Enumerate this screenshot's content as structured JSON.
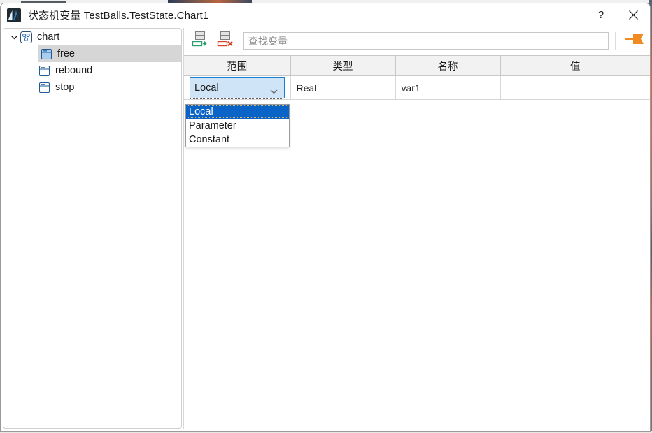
{
  "window": {
    "title": "状态机变量 TestBalls.TestState.Chart1",
    "app_icon": "matlab-logo-icon",
    "help_label": "?",
    "close_label": "close-icon"
  },
  "tree": {
    "root": {
      "label": "chart",
      "icon": "chart-state-machine-icon",
      "expanded": true,
      "twisty": "chevron-down-icon"
    },
    "children": [
      {
        "label": "free",
        "icon": "state-icon",
        "selected": true
      },
      {
        "label": "rebound",
        "icon": "state-icon",
        "selected": false
      },
      {
        "label": "stop",
        "icon": "state-icon",
        "selected": false
      }
    ]
  },
  "toolbar": {
    "add_variable_icon": "add-variable-icon",
    "delete_variable_icon": "delete-variable-icon",
    "search_placeholder": "查找变量",
    "search_value": "",
    "flag_icon": "orange-arrow-flag-icon"
  },
  "table": {
    "columns": [
      "范围",
      "类型",
      "名称",
      "值"
    ],
    "rows": [
      {
        "scope": "Local",
        "type": "Real",
        "name": "var1",
        "value": ""
      }
    ]
  },
  "dropdown": {
    "open": true,
    "selected": "Local",
    "options": [
      "Local",
      "Parameter",
      "Constant"
    ]
  },
  "colors": {
    "accent_blue": "#0a64c8",
    "combo_fill": "#cfe4f7",
    "combo_border": "#1a7fd4",
    "selection_gray": "#d6d6d6",
    "header_gray": "#f2f2f2",
    "flag_orange": "#f08a23",
    "add_green": "#2f9e6e",
    "delete_red": "#d6422b"
  }
}
